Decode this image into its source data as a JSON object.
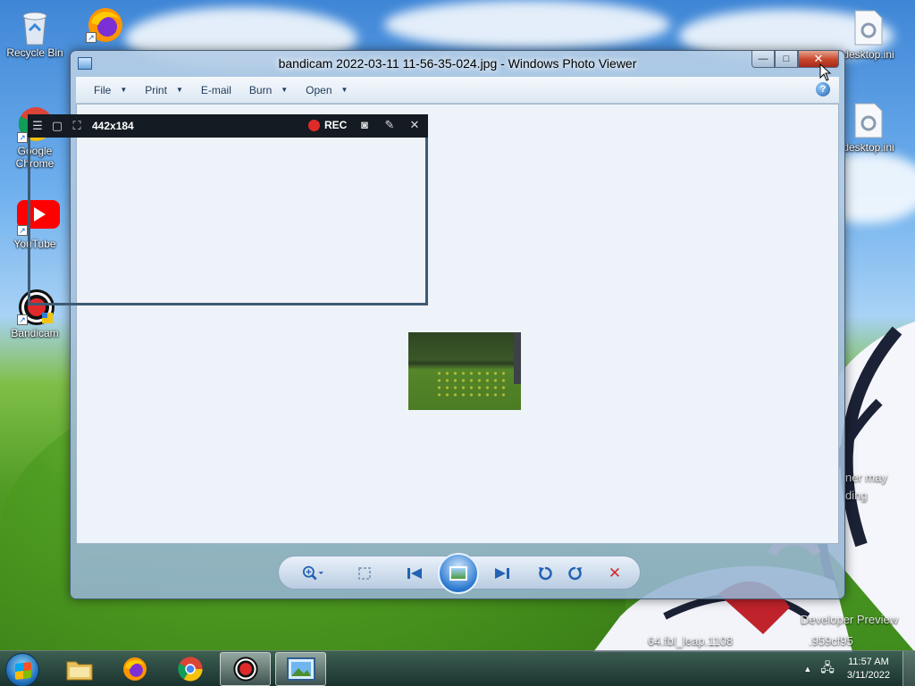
{
  "desktop": {
    "icons": [
      {
        "label": "Recycle Bin"
      },
      {
        "label": "Google Chrome"
      },
      {
        "label": "YouTube"
      },
      {
        "label": "Bandicam"
      },
      {
        "label": "desktop.ini"
      },
      {
        "label": "desktop.ini"
      }
    ],
    "watermark": {
      "line1": "Developer Preview",
      "line2": "64.fbl_leap.1108",
      "line3": ".959cf95",
      "partial1": "ner may",
      "partial2": "ding"
    }
  },
  "window": {
    "title": "bandicam 2022-03-11 11-56-35-024.jpg - Windows Photo Viewer",
    "caption_buttons": {
      "minimize": "—",
      "maximize": "□",
      "close": "✕"
    },
    "menu": [
      {
        "label": "File",
        "has_dropdown": true
      },
      {
        "label": "Print",
        "has_dropdown": true
      },
      {
        "label": "E-mail",
        "has_dropdown": false
      },
      {
        "label": "Burn",
        "has_dropdown": true
      },
      {
        "label": "Open",
        "has_dropdown": true
      }
    ],
    "help": "?",
    "toolbar": [
      {
        "name": "zoom-button",
        "icon": "magnifier-icon"
      },
      {
        "name": "actual-size-button",
        "icon": "actual-size-icon"
      },
      {
        "name": "previous-button",
        "icon": "previous-icon"
      },
      {
        "name": "slideshow-button",
        "icon": "slideshow-icon"
      },
      {
        "name": "next-button",
        "icon": "next-icon"
      },
      {
        "name": "rotate-left-button",
        "icon": "rotate-ccw-icon"
      },
      {
        "name": "rotate-right-button",
        "icon": "rotate-cw-icon"
      },
      {
        "name": "delete-button",
        "icon": "delete-icon"
      }
    ]
  },
  "bandicam": {
    "size_label": "442x184",
    "rec_label": "REC"
  },
  "taskbar": {
    "time": "11:57 AM",
    "date": "3/11/2022",
    "apps": [
      "Windows Explorer",
      "Firefox",
      "Google Chrome",
      "Bandicam",
      "Windows Photo Viewer"
    ],
    "active_app": "Windows Photo Viewer"
  },
  "colors": {
    "close_button": "#c7452a",
    "rec_dot": "#e02a2a",
    "delete_x": "#d02a2a",
    "accent": "#2462b3"
  }
}
